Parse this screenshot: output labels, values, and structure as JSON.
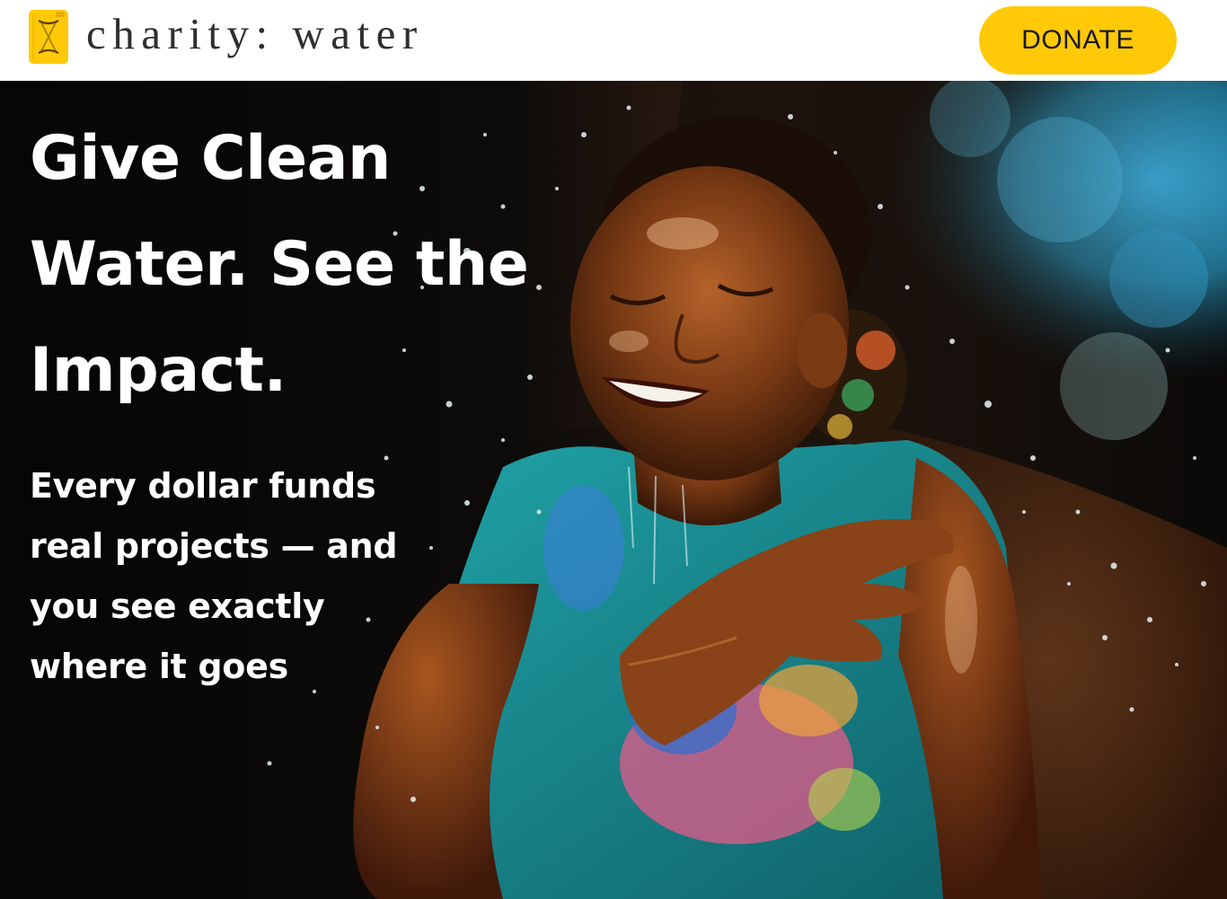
{
  "header": {
    "logo_text": "charity: water",
    "logo_icon": "jerrycan-icon",
    "donate_label": "DONATE"
  },
  "hero": {
    "title": "Give Clean Water. See the Impact.",
    "subtitle": "Every dollar funds real projects — and you see exactly where it goes",
    "image_subject": "girl-splashing-water-photo"
  },
  "colors": {
    "brand_yellow": "#ffc907",
    "text_dark": "#2f2f2f",
    "hero_text": "#ffffff"
  }
}
